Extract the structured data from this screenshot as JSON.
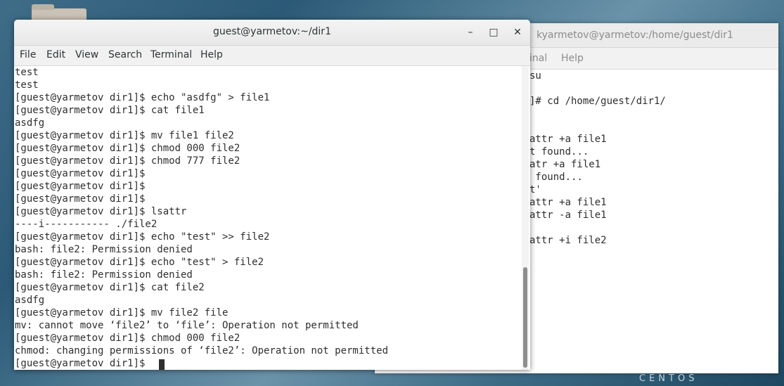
{
  "desktop": {
    "brand": "CENTOS"
  },
  "background_window": {
    "title": "kyarmetov@yarmetov:/home/guest/dir1",
    "menu": [
      "inal",
      "Help"
    ],
    "lines": [
      "su",
      "",
      "]# cd /home/guest/dir1/",
      "",
      "",
      "attr +a file1",
      "t found...",
      "atr +a file1",
      " found...",
      "t'",
      "attr +a file1",
      "attr -a file1",
      "",
      "attr +i file2"
    ]
  },
  "window": {
    "title": "guest@yarmetov:~/dir1",
    "minimize_label": "–",
    "maximize_label": "□",
    "close_label": "✕"
  },
  "menubar": {
    "items": [
      "File",
      "Edit",
      "View",
      "Search",
      "Terminal",
      "Help"
    ]
  },
  "terminal": {
    "lines": [
      "test",
      "test",
      "[guest@yarmetov dir1]$ echo \"asdfg\" > file1",
      "[guest@yarmetov dir1]$ cat file1",
      "asdfg",
      "[guest@yarmetov dir1]$ mv file1 file2",
      "[guest@yarmetov dir1]$ chmod 000 file2",
      "[guest@yarmetov dir1]$ chmod 777 file2",
      "[guest@yarmetov dir1]$",
      "[guest@yarmetov dir1]$",
      "[guest@yarmetov dir1]$",
      "[guest@yarmetov dir1]$ lsattr",
      "----i----------- ./file2",
      "[guest@yarmetov dir1]$ echo \"test\" >> file2",
      "bash: file2: Permission denied",
      "[guest@yarmetov dir1]$ echo \"test\" > file2",
      "bash: file2: Permission denied",
      "[guest@yarmetov dir1]$ cat file2",
      "asdfg",
      "[guest@yarmetov dir1]$ mv file2 file",
      "mv: cannot move ‘file2’ to ‘file’: Operation not permitted",
      "[guest@yarmetov dir1]$ chmod 000 file2",
      "chmod: changing permissions of ‘file2’: Operation not permitted",
      "[guest@yarmetov dir1]$"
    ]
  },
  "scrollbar": {
    "position_fraction": 0.66
  }
}
